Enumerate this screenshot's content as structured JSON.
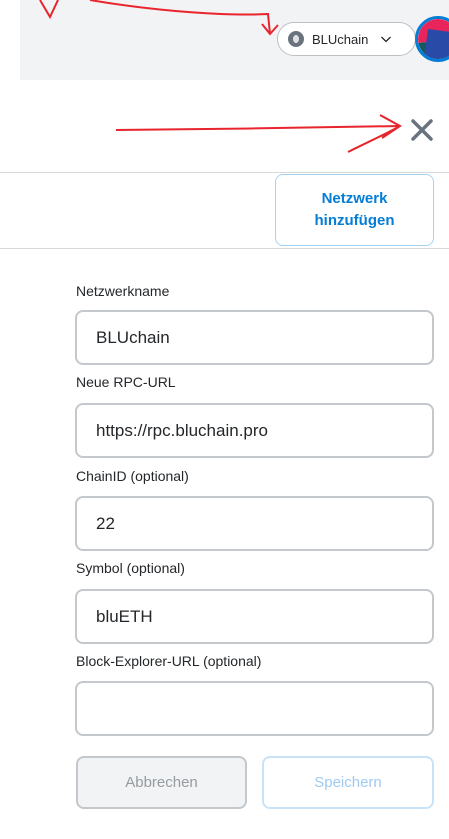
{
  "header": {
    "network": {
      "name": "BLUchain"
    }
  },
  "main": {
    "add_network_button": {
      "line1": "Netzwerk",
      "line2": "hinzufügen"
    },
    "form": {
      "fields": [
        {
          "label": "Netzwerkname",
          "value": "BLUchain"
        },
        {
          "label": "Neue RPC-URL",
          "value": "https://rpc.bluchain.pro"
        },
        {
          "label": "ChainID (optional)",
          "value": "22"
        },
        {
          "label": "Symbol (optional)",
          "value": "bluETH"
        },
        {
          "label": "Block-Explorer-URL (optional)",
          "value": ""
        }
      ],
      "cancel_label": "Abbrechen",
      "save_label": "Speichern"
    }
  },
  "colors": {
    "accent": "#037dd6",
    "annotation": "#e8242d",
    "header_background": "#f2f3f4"
  },
  "icons": {
    "network": "network-status-icon",
    "chevron": "chevron-down-icon",
    "close": "close-icon",
    "avatar": "account-avatar-icon"
  }
}
